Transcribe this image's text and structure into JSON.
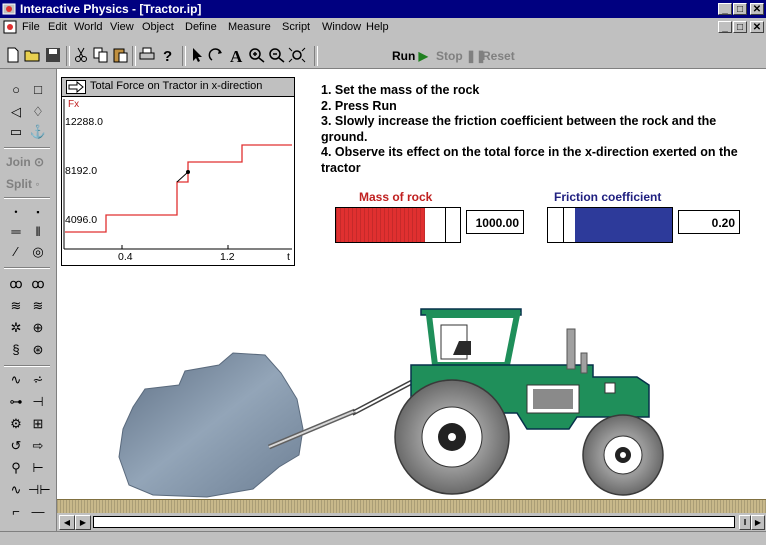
{
  "window": {
    "title": "Interactive Physics - [Tractor.ip]",
    "controls": {
      "minimize": "_",
      "maximize": "□",
      "close": "✕"
    }
  },
  "menu": [
    {
      "label": "File"
    },
    {
      "label": "Edit"
    },
    {
      "label": "World"
    },
    {
      "label": "View"
    },
    {
      "label": "Object"
    },
    {
      "label": "Define"
    },
    {
      "label": "Measure"
    },
    {
      "label": "Script"
    },
    {
      "label": "Window"
    },
    {
      "label": "Help"
    }
  ],
  "toolbar": {
    "run_label": "Run",
    "stop_label": "Stop",
    "reset_label": "Reset",
    "icons": [
      "new-icon",
      "open-icon",
      "save-icon",
      "cut-icon",
      "copy-icon",
      "paste-icon",
      "print-icon",
      "help-icon",
      "arrow-icon",
      "rotate-icon",
      "text-icon",
      "zoom-in-icon",
      "zoom-out-icon",
      "fit-icon"
    ]
  },
  "palette": {
    "join_label": "Join",
    "split_label": "Split"
  },
  "graph": {
    "title": "Total Force on Tractor in x-direction",
    "y_label": "Fx",
    "x_label": "t",
    "y_ticks": [
      "12288.0",
      "8192.0",
      "4096.0"
    ],
    "x_ticks": [
      "0.4",
      "1.2"
    ]
  },
  "instructions": [
    "1. Set the mass of the rock",
    "2. Press Run",
    "3. Slowly increase the friction coefficient between the rock and the ground.",
    "4. Observe its effect on the total force in the x-direction exerted on the tractor"
  ],
  "mass_control": {
    "label": "Mass of rock",
    "value": "1000.00",
    "fill_fraction": 0.72,
    "color": "#e03030"
  },
  "friction_control": {
    "label": "Friction coefficient",
    "value": "0.20",
    "fill_fraction": 0.78,
    "color": "#2d3a9a"
  },
  "colors": {
    "tractor": "#1f8f5a",
    "rock": "#7f93a8",
    "ground": "#c8b88a",
    "label_red": "#c02020",
    "label_blue": "#202080"
  }
}
